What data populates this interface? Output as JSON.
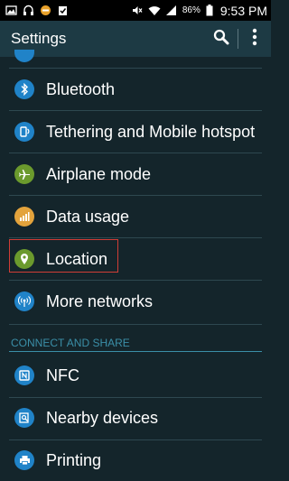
{
  "status_bar": {
    "left_icons": [
      "image-icon",
      "headphones-icon",
      "blocked-icon",
      "clipboard-check-icon"
    ],
    "right_icons": [
      "mute-icon",
      "wifi-icon",
      "signal-icon",
      "battery-icon"
    ],
    "battery": "86%",
    "time": "9:53 PM"
  },
  "header": {
    "title": "Settings",
    "actions": [
      "search-icon",
      "more-icon"
    ]
  },
  "items": [
    {
      "label": "Bluetooth",
      "icon": "bluetooth-icon",
      "color": "#2083c8"
    },
    {
      "label": "Tethering and Mobile hotspot",
      "icon": "hotspot-icon",
      "color": "#2083c8"
    },
    {
      "label": "Airplane mode",
      "icon": "airplane-icon",
      "color": "#6b9a2d"
    },
    {
      "label": "Data usage",
      "icon": "data-usage-icon",
      "color": "#e3a33c"
    },
    {
      "label": "Location",
      "icon": "location-icon",
      "color": "#6b9a2d"
    },
    {
      "label": "More networks",
      "icon": "networks-icon",
      "color": "#2083c8"
    }
  ],
  "section": {
    "title": "CONNECT AND SHARE"
  },
  "share_items": [
    {
      "label": "NFC",
      "icon": "nfc-icon",
      "color": "#2083c8"
    },
    {
      "label": "Nearby devices",
      "icon": "nearby-devices-icon",
      "color": "#2083c8"
    },
    {
      "label": "Printing",
      "icon": "printer-icon",
      "color": "#2083c8"
    }
  ],
  "colors": {
    "status_bar": "#000000",
    "action_bar": "#1d3a44",
    "background": "#14252b",
    "accent": "#3b8fa8",
    "highlight": "#d03d36"
  }
}
